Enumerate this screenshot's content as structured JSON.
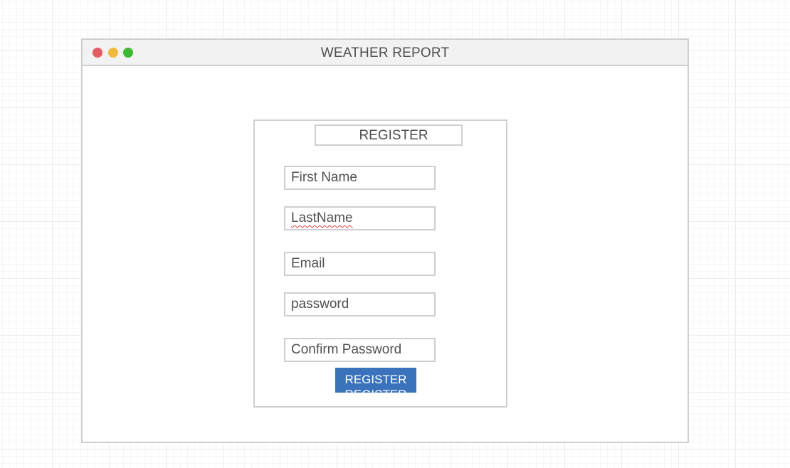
{
  "window": {
    "title": "WEATHER REPORT",
    "controls": [
      {
        "name": "close",
        "color": "#e55b63"
      },
      {
        "name": "minimize",
        "color": "#f0b93c"
      },
      {
        "name": "maximize",
        "color": "#3cb832"
      }
    ]
  },
  "form": {
    "header": "REGISTER",
    "fields": {
      "first_name": "First Name",
      "last_name": "LastName",
      "email": "Email",
      "password": "password",
      "confirm_password": "Confirm Password"
    },
    "submit_label": "REGISTER"
  }
}
